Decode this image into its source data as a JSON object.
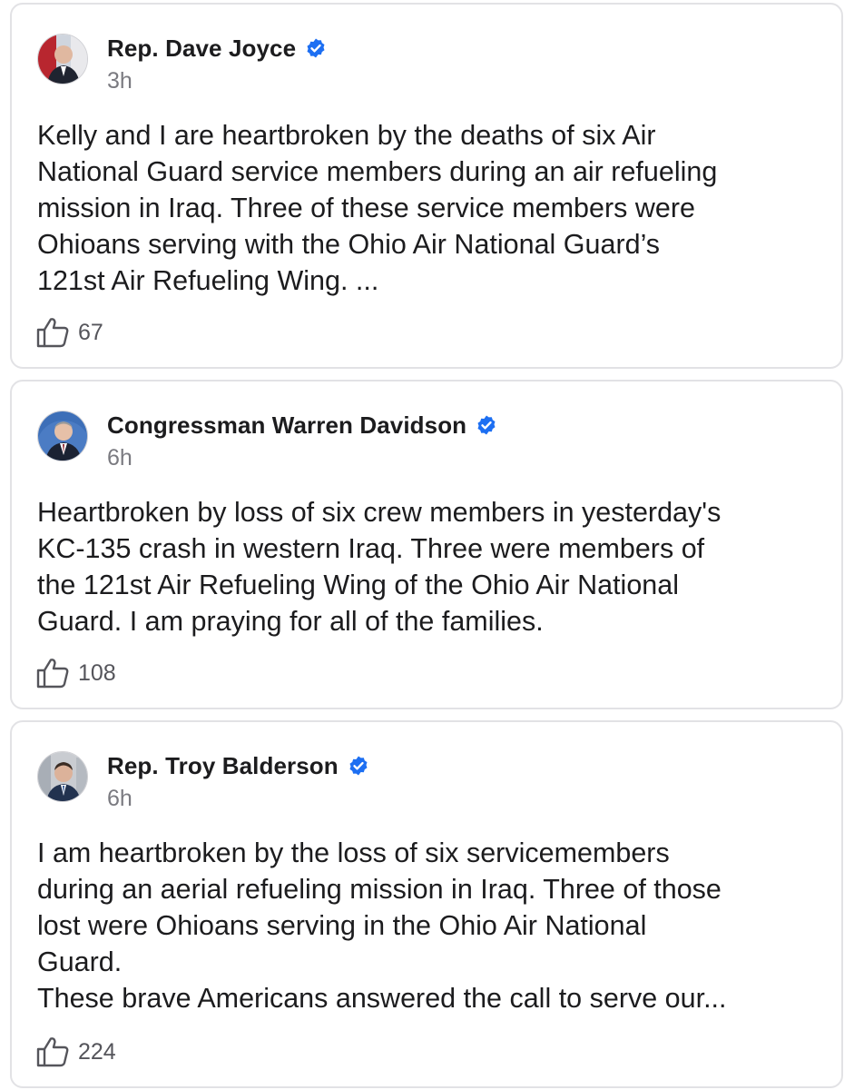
{
  "posts": [
    {
      "author": "Rep. Dave Joyce",
      "verified": true,
      "time": "3h",
      "body_lines": [
        "Kelly and I are heartbroken by the deaths of six Air",
        "National Guard service members during an air refueling",
        "mission in Iraq. Three of these service members were",
        "Ohioans serving with the Ohio Air National Guard’s",
        "121st Air Refueling Wing. ..."
      ],
      "likes": "67"
    },
    {
      "author": "Congressman Warren Davidson",
      "verified": true,
      "time": "6h",
      "body_lines": [
        "Heartbroken by loss of six crew members in yesterday's",
        "KC-135 crash in western Iraq. Three were members of",
        "the 121st Air Refueling Wing of the Ohio Air National",
        "Guard. I am praying for all of the families."
      ],
      "likes": "108"
    },
    {
      "author": "Rep. Troy Balderson",
      "verified": true,
      "time": "6h",
      "body_lines": [
        "I am heartbroken by the loss of six servicemembers",
        "during an aerial refueling mission in Iraq. Three of those",
        "lost were Ohioans serving in the Ohio Air National",
        "Guard.",
        "These brave Americans answered the call to serve our..."
      ],
      "likes": "224"
    }
  ],
  "icons": {
    "verified": "verified-badge-icon",
    "like": "thumbs-up-icon"
  },
  "colors": {
    "verified_blue": "#1d6ff2",
    "text": "#1c1c1e",
    "secondary_text": "#7a7a80",
    "card_border": "#e2e2e5"
  }
}
